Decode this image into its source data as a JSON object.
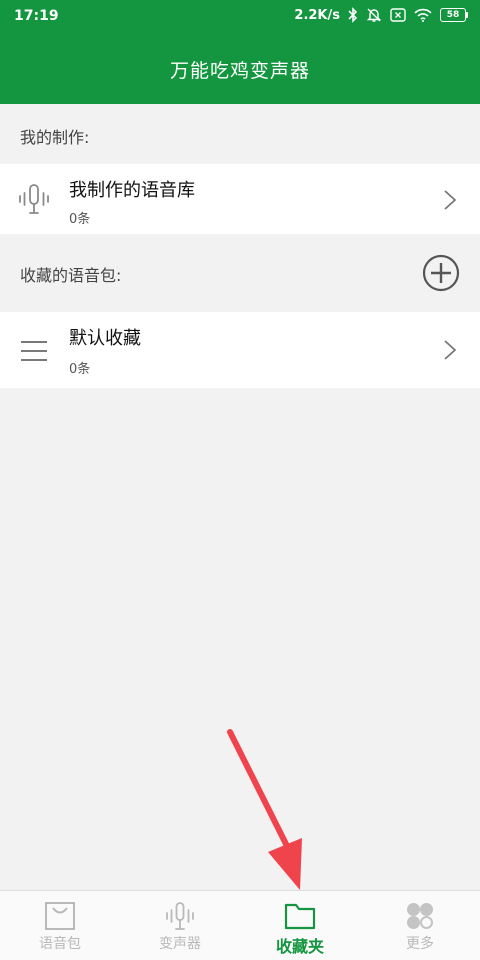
{
  "status_bar": {
    "time": "17:19",
    "network_speed": "2.2K/s",
    "battery": "58",
    "icons": [
      "bluetooth-icon",
      "mute-bell-icon",
      "sim-x-icon",
      "wifi-icon",
      "battery-icon"
    ]
  },
  "header": {
    "title": "万能吃鸡变声器"
  },
  "my_creations": {
    "section_label": "我的制作:",
    "item": {
      "title": "我制作的语音库",
      "count": "0条",
      "icon": "microphone-wave-icon"
    }
  },
  "favorites": {
    "section_label": "收藏的语音包:",
    "add_icon": "add-circle-icon",
    "item": {
      "title": "默认收藏",
      "count": "0条",
      "icon": "menu-lines-icon"
    }
  },
  "tab_bar": {
    "tabs": [
      {
        "label": "语音包",
        "icon": "bag-icon",
        "active": false
      },
      {
        "label": "变声器",
        "icon": "microphone-wave-icon",
        "active": false
      },
      {
        "label": "收藏夹",
        "icon": "folder-icon",
        "active": true
      },
      {
        "label": "更多",
        "icon": "four-petal-icon",
        "active": false
      }
    ]
  },
  "colors": {
    "brand_green": "#13963f",
    "background": "#f2f2f2",
    "inactive_tab": "#b9b9b9",
    "annotation_arrow": "#f0444c"
  }
}
